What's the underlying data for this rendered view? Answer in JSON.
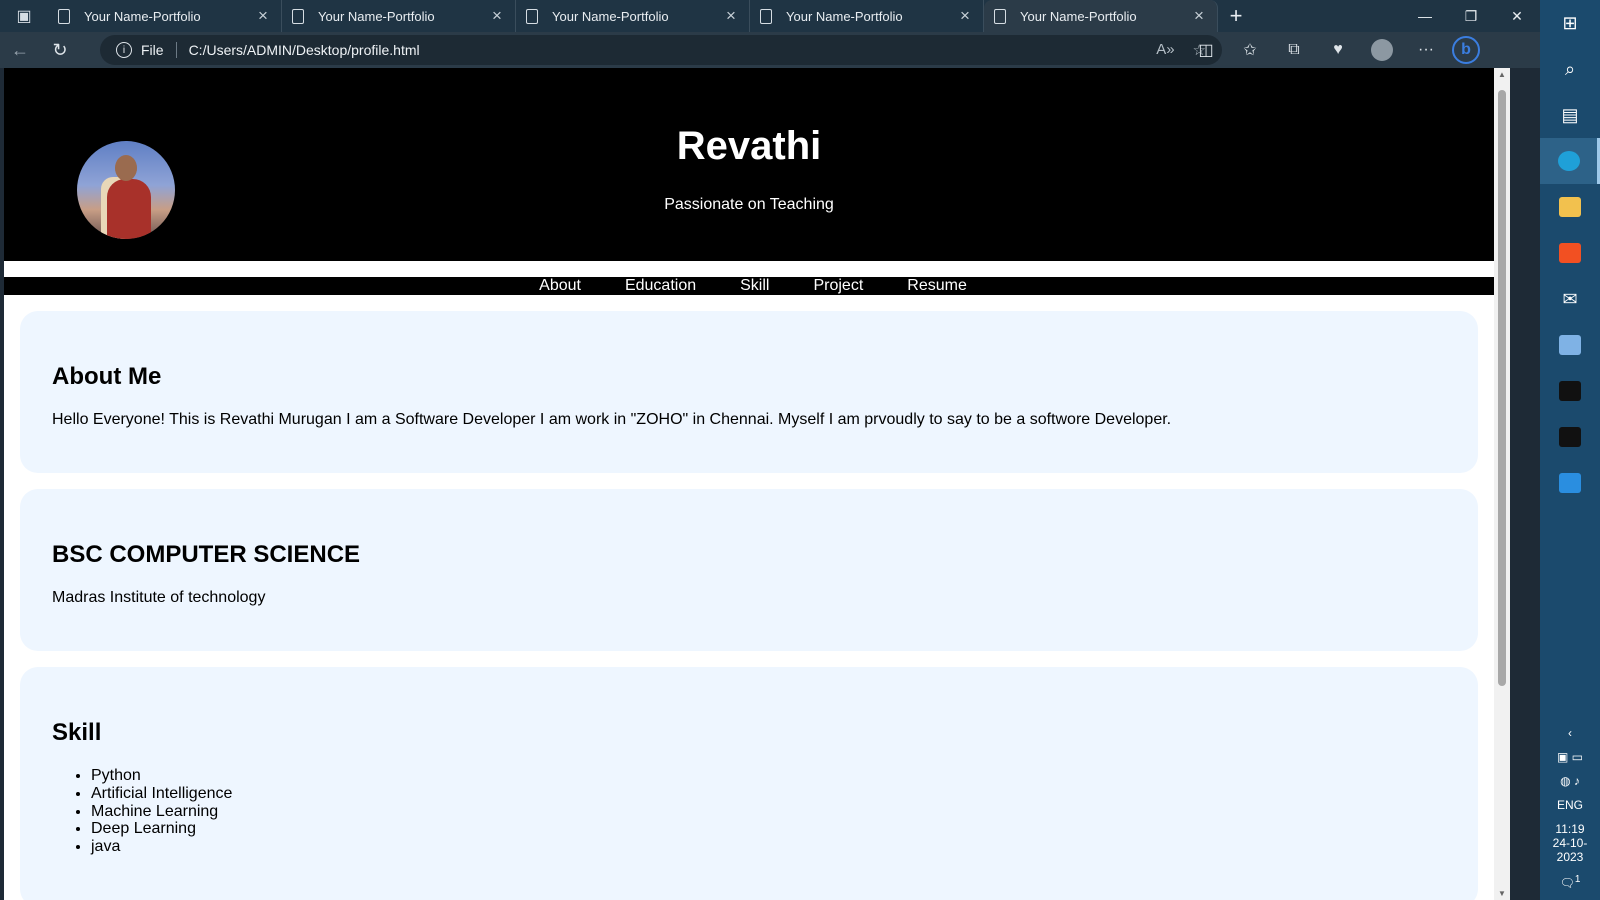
{
  "browser": {
    "tabs": [
      {
        "title": "Your Name-Portfolio"
      },
      {
        "title": "Your Name-Portfolio"
      },
      {
        "title": "Your Name-Portfolio"
      },
      {
        "title": "Your Name-Portfolio"
      },
      {
        "title": "Your Name-Portfolio"
      }
    ],
    "active_tab": 4,
    "address": {
      "scheme": "File",
      "url": "C:/Users/ADMIN/Desktop/profile.html"
    }
  },
  "page": {
    "header": {
      "name": "Revathi",
      "tagline": "Passionate on Teaching"
    },
    "nav": [
      {
        "label": "About"
      },
      {
        "label": "Education"
      },
      {
        "label": "Skill"
      },
      {
        "label": "Project"
      },
      {
        "label": "Resume"
      }
    ],
    "about": {
      "heading": "About Me",
      "text": "Hello Everyone! This is Revathi Murugan I am a Software Developer I am work in \"ZOHO\" in Chennai. Myself I am prvoudly to say to be a softwore Developer."
    },
    "education": {
      "heading": "BSC COMPUTER SCIENCE",
      "text": "Madras Institute of technology"
    },
    "skill": {
      "heading": "Skill",
      "items": [
        "Python",
        "Artificial Intelligence",
        "Machine Learning",
        "Deep Learning",
        "java"
      ]
    }
  },
  "taskbar": {
    "language": "ENG",
    "time": "11:19",
    "date": "24-10-2023",
    "notification_count": "1"
  },
  "colors": {
    "hero_bg": "#000000",
    "card_bg": "#eef6ff",
    "taskbar_bg": "#1b4a6d",
    "browser_chrome": "#2b3b48"
  }
}
